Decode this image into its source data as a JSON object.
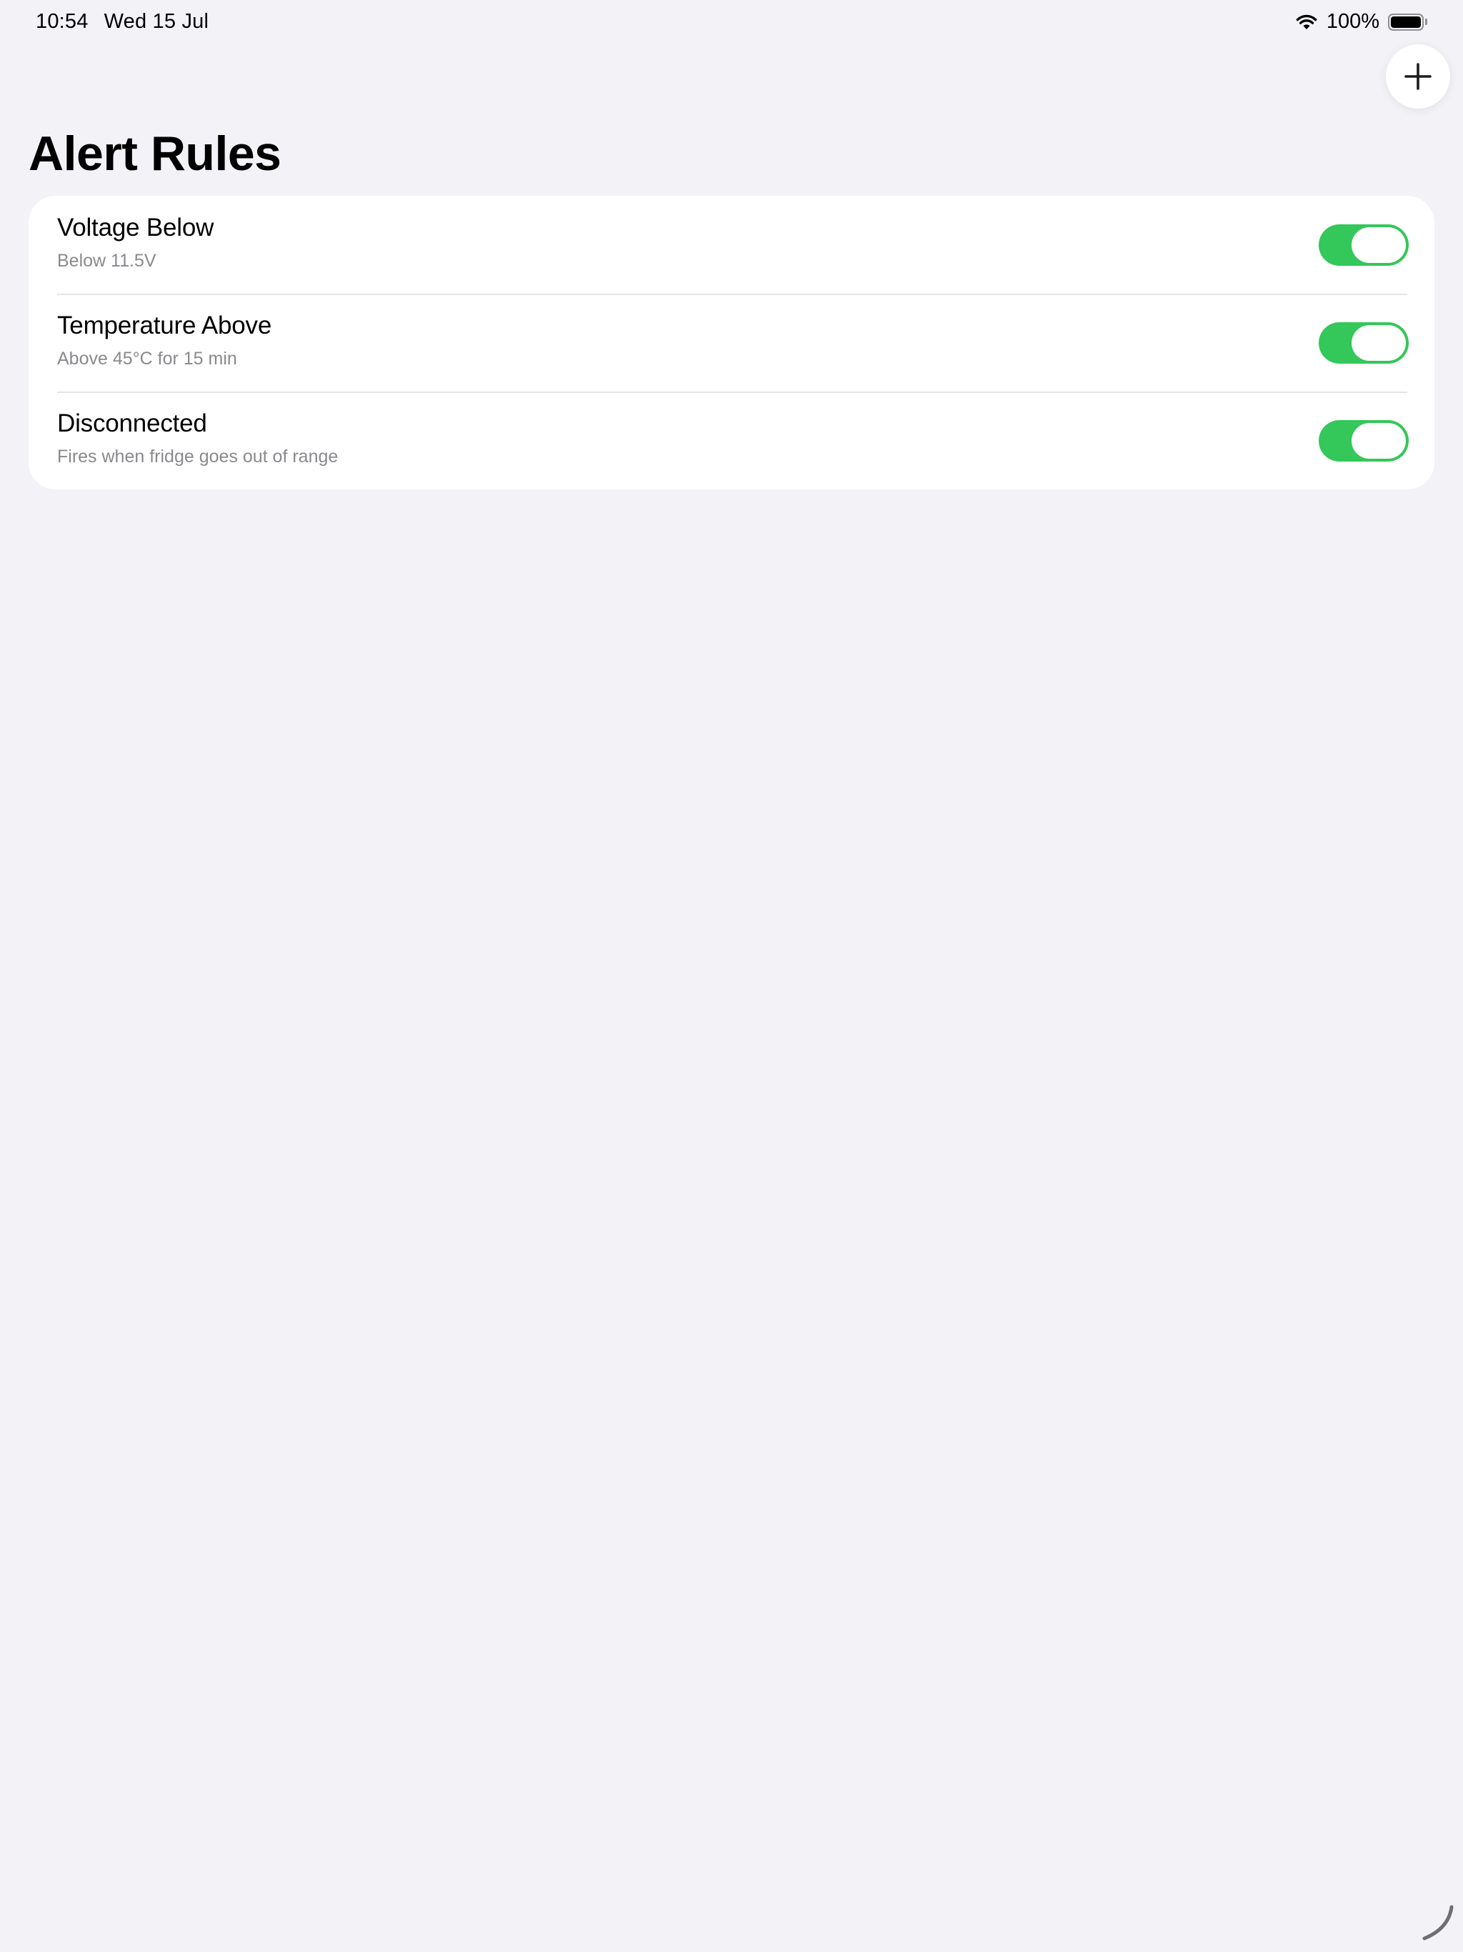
{
  "status_bar": {
    "time": "10:54",
    "date": "Wed 15 Jul",
    "battery_percent": "100%",
    "battery_level": 1.0
  },
  "header": {
    "title": "Alert Rules",
    "add_icon": "plus-icon"
  },
  "rules": [
    {
      "title": "Voltage Below",
      "subtitle": "Below 11.5V",
      "enabled": true
    },
    {
      "title": "Temperature Above",
      "subtitle": "Above 45°C for 15 min",
      "enabled": true
    },
    {
      "title": "Disconnected",
      "subtitle": "Fires when fridge goes out of range",
      "enabled": true
    }
  ],
  "colors": {
    "background": "#f2f2f7",
    "card": "#ffffff",
    "toggle_on": "#34c759",
    "secondary_text": "#8a8a8e"
  }
}
